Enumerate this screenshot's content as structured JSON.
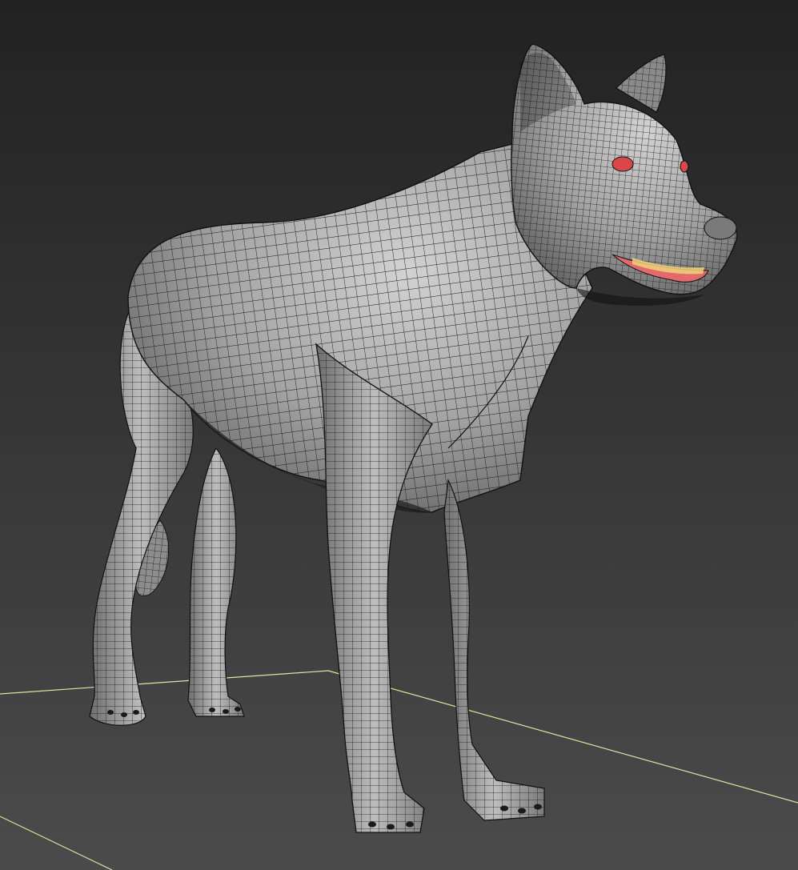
{
  "viewport": {
    "mode": "perspective",
    "display": "smooth-shaded-with-wireframe-edges",
    "object": "wolf-mesh"
  },
  "colors": {
    "background_top": "#222222",
    "background_bottom": "#4b4b4b",
    "grid_line": "#e6dfa0",
    "mesh_fill": "#9b9b9b",
    "mesh_highlight": "#cfcfcf",
    "wire": "#1a1a1a",
    "eye": "#d94848",
    "gum": "#e36a6a",
    "teeth": "#f0d27a"
  },
  "icons": {
    "mesh": "wolf-mesh-icon",
    "ground": "ground-grid-icon"
  }
}
